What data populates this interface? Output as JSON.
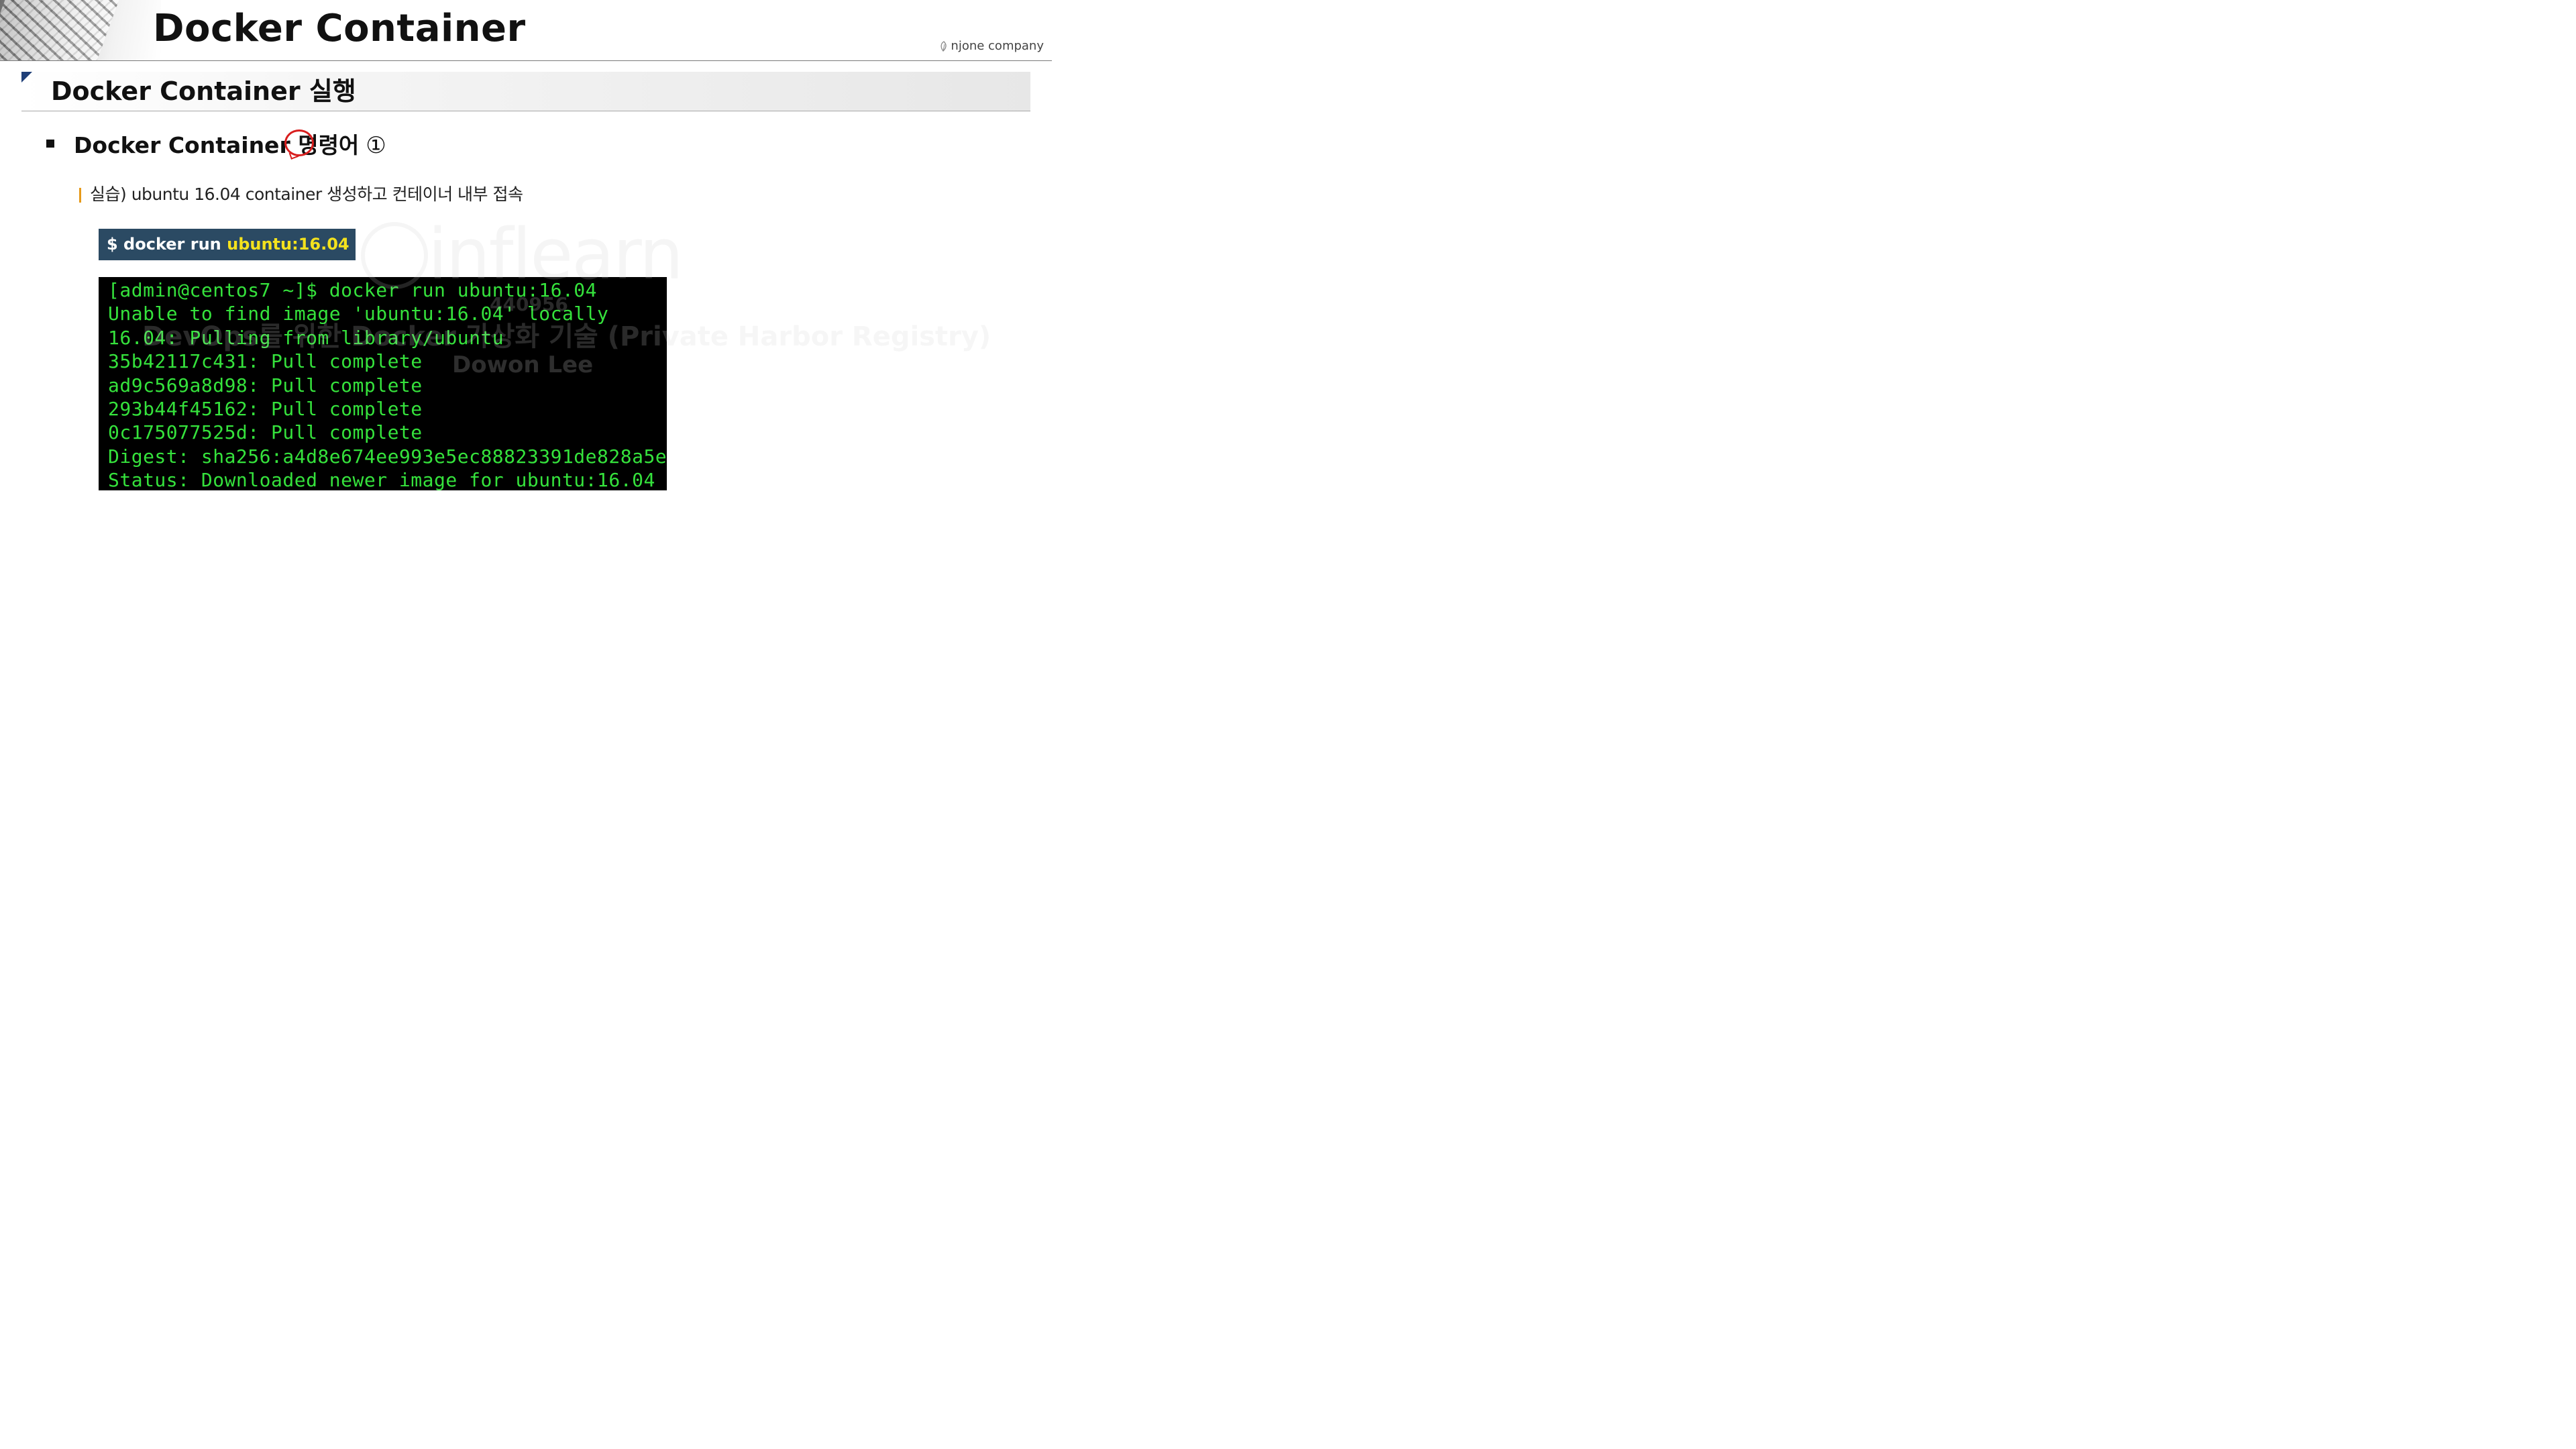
{
  "header": {
    "title": "Docker Container",
    "brand": "njone company",
    "brand_icon": "leaf-logo-icon"
  },
  "section": {
    "title": "Docker Container 실행"
  },
  "bullet": {
    "heading": "Docker Container 명령어",
    "number": "①",
    "annotation": "red-circle-highlight"
  },
  "subitem": {
    "text": "실습) ubuntu 16.04 container 생성하고 컨테이너 내부 접속"
  },
  "command": {
    "prefix": "$ docker run ",
    "arg": "ubuntu:16.04"
  },
  "terminal": {
    "lines": [
      "[admin@centos7 ~]$ docker run ubuntu:16.04",
      "Unable to find image 'ubuntu:16.04' locally",
      "16.04: Pulling from library/ubuntu",
      "35b42117c431: Pull complete",
      "ad9c569a8d98: Pull complete",
      "293b44f45162: Pull complete",
      "0c175077525d: Pull complete",
      "Digest: sha256:a4d8e674ee993e5ec88823391de828a5e",
      "Status: Downloaded newer image for ubuntu:16.04"
    ]
  },
  "watermark": {
    "logo_text": "inflearn",
    "course": "DevOps를 위한 Docker 가상화 기술 (Private Harbor Registry)",
    "id": "440956",
    "author": "Dowon Lee"
  },
  "colors": {
    "terminal_bg": "#000000",
    "terminal_text": "#35e23c",
    "command_bg": "#2b4a63",
    "command_arg": "#f4e21d",
    "accent_orange": "#e69a1a",
    "annotation_red": "#d81e1e",
    "corner_blue": "#1f3f78"
  }
}
